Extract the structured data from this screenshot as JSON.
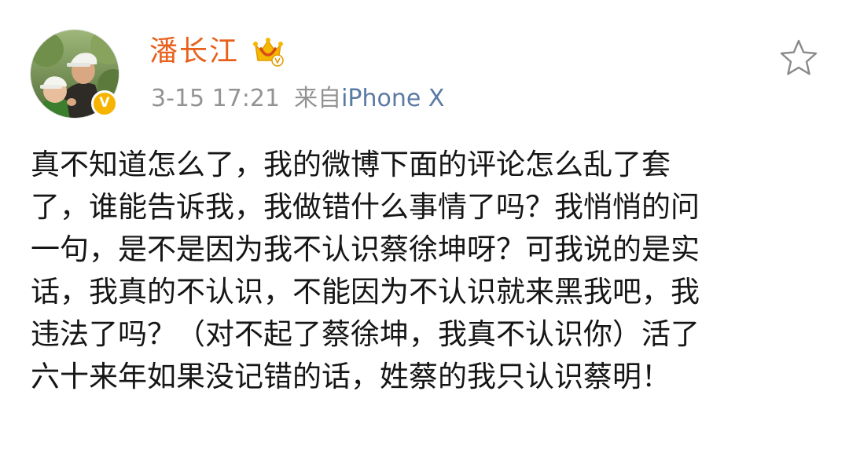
{
  "post": {
    "author": {
      "name": "潘长江",
      "avatar": "avatar-photo-icon",
      "verified_badge": "V",
      "vip_icon": "crown-vip-icon"
    },
    "timestamp": "3-15 17:21",
    "source_prefix": "来自",
    "source": "iPhone X",
    "favorite_icon": "star-outline-icon",
    "lines": [
      "真不知道怎么了，我的微博下面的评论怎么乱了套",
      "了，谁能告诉我，我做错什么事情了吗？我悄悄的问",
      "一句，是不是因为我不认识蔡徐坤呀？可我说的是实",
      "话，我真的不认识，不能因为不认识就来黑我吧，我",
      "违法了吗？（对不起了蔡徐坤，我真不认识你）活了",
      "六十来年如果没记错的话，姓蔡的我只认识蔡明！"
    ]
  },
  "colors": {
    "username": "#e8601c",
    "meta": "#939393",
    "source_link": "#5b7aa3",
    "body_text": "#161616",
    "verified": "#f6b400",
    "vip_crown": "#f5b800"
  }
}
